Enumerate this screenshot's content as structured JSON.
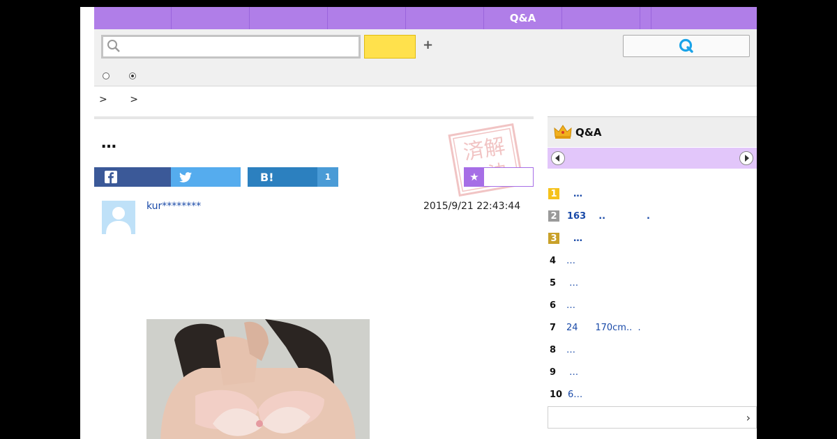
{
  "nav": {
    "tabs": [
      "",
      "",
      "",
      "",
      "",
      "Q&A",
      "",
      "",
      ""
    ]
  },
  "search": {
    "placeholder": "",
    "query": ""
  },
  "breadcrumb": [
    ">",
    ">"
  ],
  "question": {
    "title": "…",
    "user": "kur********",
    "date": "2015/9/21  22:43:44"
  },
  "share": {
    "hatena_label": "B!",
    "hatena_count": "1",
    "fav_label": "★"
  },
  "sidebar": {
    "title": "Q&A",
    "rankings": [
      {
        "num": "1",
        "text": "  …",
        "style": "gold",
        "bold": true
      },
      {
        "num": "2",
        "text": "163    ..             .",
        "style": "silver",
        "bold": true
      },
      {
        "num": "3",
        "text": "  …",
        "style": "bronze",
        "bold": true
      },
      {
        "num": "4",
        "text": "…",
        "style": "plain",
        "bold": false
      },
      {
        "num": "5",
        "text": " …",
        "style": "plain",
        "bold": false
      },
      {
        "num": "6",
        "text": "…",
        "style": "plain",
        "bold": false
      },
      {
        "num": "7",
        "text": "24      170cm..  .",
        "style": "plain",
        "bold": false
      },
      {
        "num": "8",
        "text": "…",
        "style": "plain",
        "bold": false
      },
      {
        "num": "9",
        "text": " …",
        "style": "plain",
        "bold": false
      },
      {
        "num": "10",
        "text": "6…",
        "style": "plain",
        "bold": false
      }
    ]
  },
  "colors": {
    "nav": "#b07ee8",
    "link": "#1a4aa8",
    "facebook": "#3b5998",
    "twitter": "#55acee",
    "hatena": "#2c80bf",
    "accent_yellow": "#ffe14c"
  },
  "icons": [
    "search-icon",
    "plus-icon",
    "q-search-icon",
    "facebook-icon",
    "twitter-icon",
    "star-icon",
    "crown-icon",
    "arrow-left-icon",
    "arrow-right-icon",
    "chevron-right-icon"
  ]
}
